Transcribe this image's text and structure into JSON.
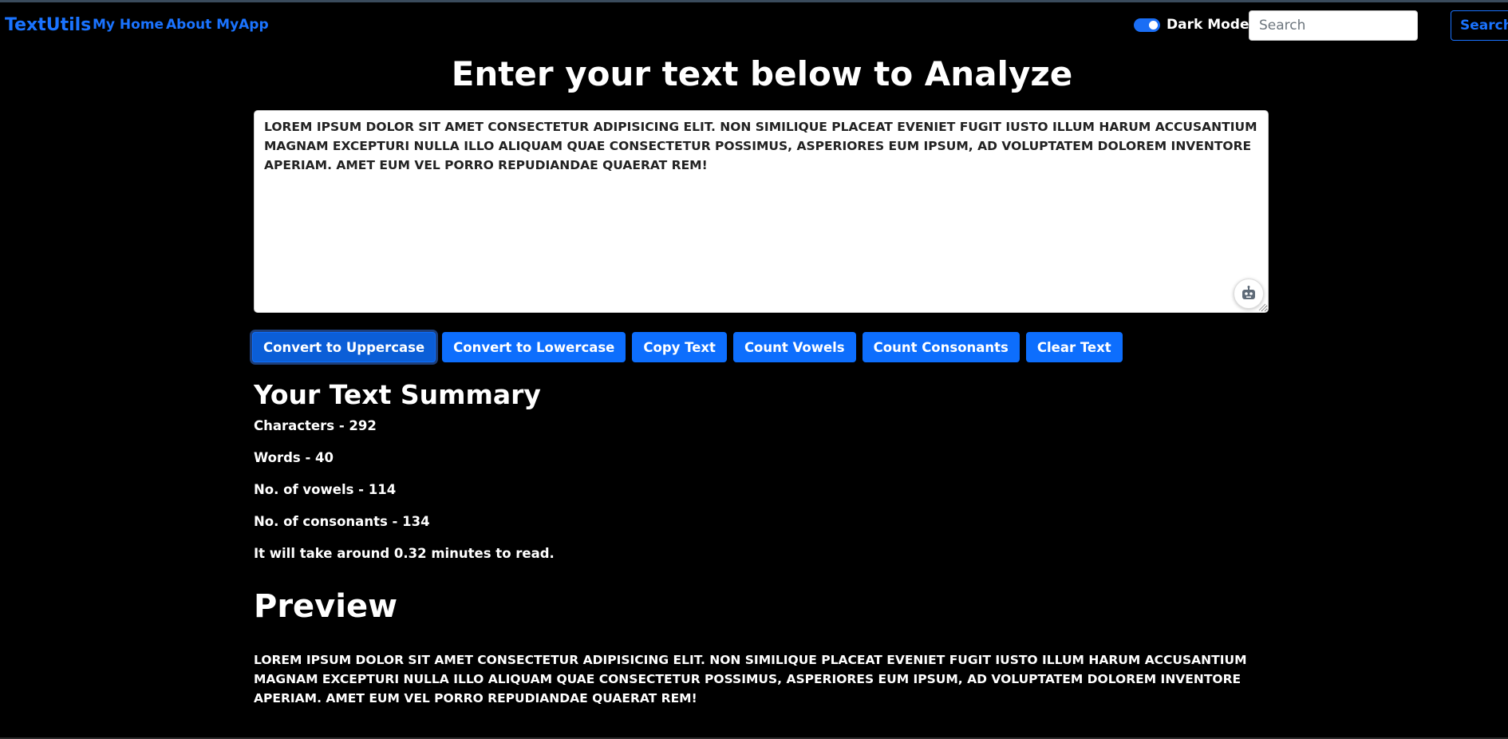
{
  "navbar": {
    "brand": "TextUtils",
    "links": [
      "My Home",
      "About MyApp"
    ],
    "dark_mode_label": "Dark Mode",
    "dark_mode_on": true,
    "search_placeholder": "Search",
    "search_button": "Search",
    "accent_color": "#1a73ff"
  },
  "main": {
    "heading": "Enter your text below to Analyze",
    "textarea_value": "LOREM IPSUM DOLOR SIT AMET CONSECTETUR ADIPISICING ELIT. NON SIMILIQUE PLACEAT EVENIET FUGIT IUSTO ILLUM HARUM ACCUSANTIUM MAGNAM EXCEPTURI NULLA ILLO ALIQUAM QUAE CONSECTETUR POSSIMUS, ASPERIORES EUM IPSUM, AD VOLUPTATEM DOLOREM INVENTORE APERIAM. AMET EUM VEL PORRO REPUDIANDAE QUAERAT REM!",
    "buttons": [
      "Convert to Uppercase",
      "Convert to Lowercase",
      "Copy Text",
      "Count Vowels",
      "Count Consonants",
      "Clear Text"
    ],
    "button_color": "#0d6efd"
  },
  "summary": {
    "heading": "Your Text Summary",
    "characters": "Characters - 292",
    "words": "Words - 40",
    "vowels": "No. of vowels - 114",
    "consonants": "No. of consonants - 134",
    "read_time": "It will take around 0.32 minutes to read."
  },
  "preview": {
    "heading": "Preview",
    "text": "LOREM IPSUM DOLOR SIT AMET CONSECTETUR ADIPISICING ELIT. NON SIMILIQUE PLACEAT EVENIET FUGIT IUSTO ILLUM HARUM ACCUSANTIUM MAGNAM EXCEPTURI NULLA ILLO ALIQUAM QUAE CONSECTETUR POSSIMUS, ASPERIORES EUM IPSUM, AD VOLUPTATEM DOLOREM INVENTORE APERIAM. AMET EUM VEL PORRO REPUDIANDAE QUAERAT REM!"
  }
}
